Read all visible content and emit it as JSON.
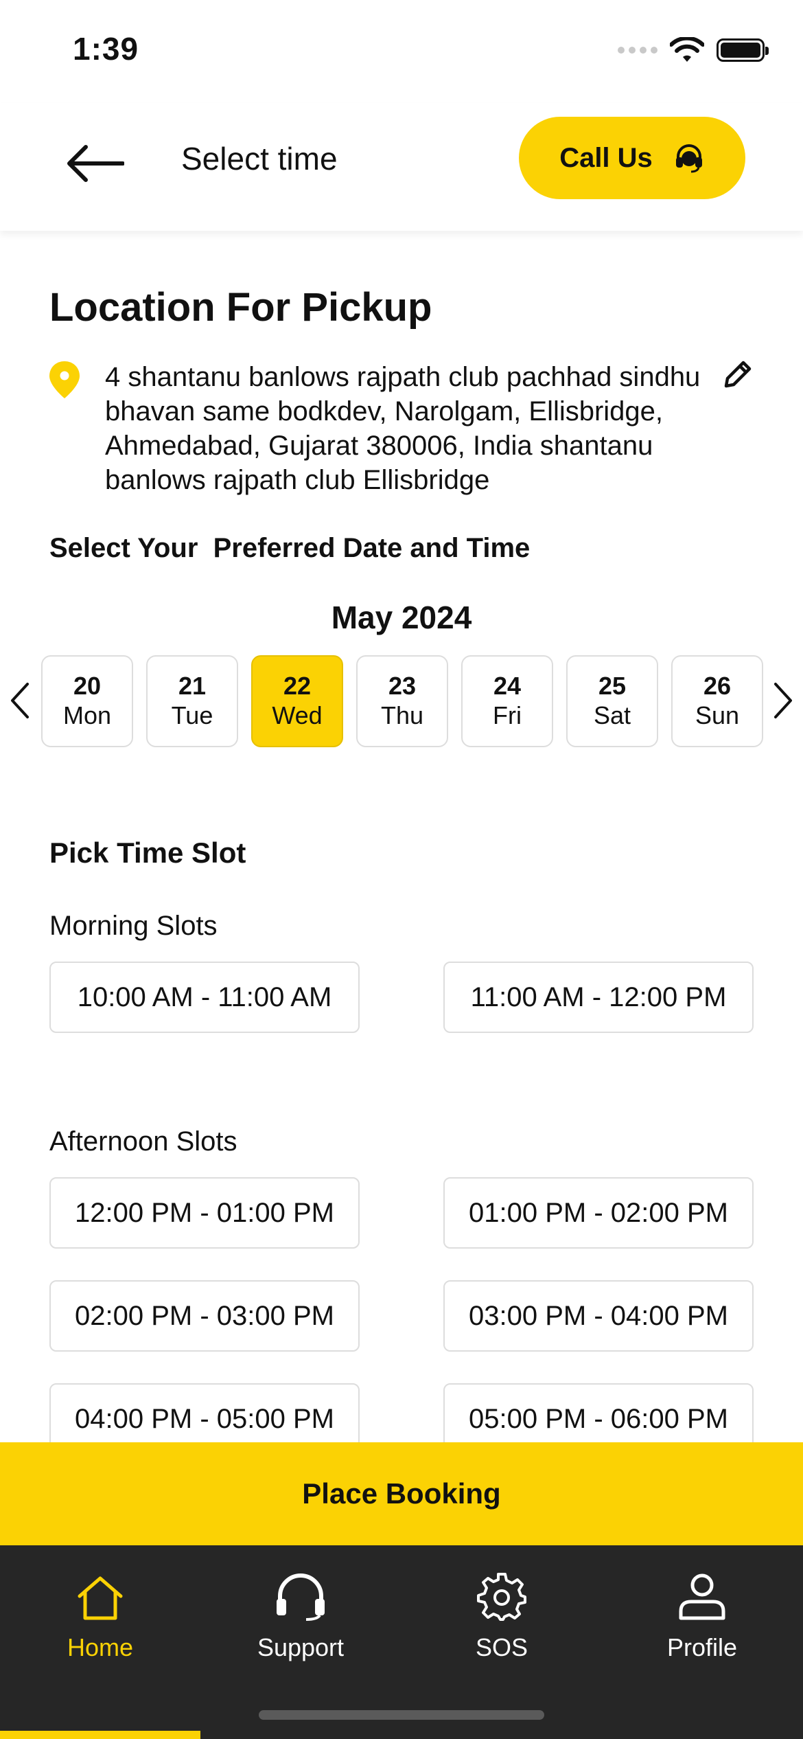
{
  "status_bar": {
    "time": "1:39"
  },
  "header": {
    "title": "Select time",
    "call_label": "Call Us"
  },
  "location": {
    "title": "Location For Pickup",
    "address": "4 shantanu banlows rajpath club pachhad sindhu bhavan same bodkdev, Narolgam, Ellisbridge, Ahmedabad, Gujarat 380006, India shantanu banlows rajpath club Ellisbridge"
  },
  "schedule": {
    "prompt": "Select Your  Preferred Date and Time",
    "month": "May 2024",
    "dates": [
      {
        "num": "20",
        "day": "Mon",
        "selected": false
      },
      {
        "num": "21",
        "day": "Tue",
        "selected": false
      },
      {
        "num": "22",
        "day": "Wed",
        "selected": true
      },
      {
        "num": "23",
        "day": "Thu",
        "selected": false
      },
      {
        "num": "24",
        "day": "Fri",
        "selected": false
      },
      {
        "num": "25",
        "day": "Sat",
        "selected": false
      },
      {
        "num": "26",
        "day": "Sun",
        "selected": false
      }
    ]
  },
  "slots": {
    "heading": "Pick Time Slot",
    "morning_label": "Morning Slots",
    "morning": [
      "10:00 AM - 11:00 AM",
      "11:00 AM - 12:00 PM"
    ],
    "afternoon_label": "Afternoon Slots",
    "afternoon": [
      "12:00 PM - 01:00 PM",
      "01:00 PM - 02:00 PM",
      "02:00 PM - 03:00 PM",
      "03:00 PM - 04:00 PM",
      "04:00 PM - 05:00 PM",
      "05:00 PM - 06:00 PM"
    ]
  },
  "place_booking_label": "Place Booking",
  "bottom_nav": {
    "items": [
      {
        "label": "Home",
        "icon": "home-icon",
        "active": true
      },
      {
        "label": "Support",
        "icon": "headset-icon",
        "active": false
      },
      {
        "label": "SOS",
        "icon": "gear-icon",
        "active": false
      },
      {
        "label": "Profile",
        "icon": "user-icon",
        "active": false
      }
    ]
  },
  "colors": {
    "accent": "#fbd204",
    "nav_bg": "#262626",
    "text": "#111111"
  }
}
